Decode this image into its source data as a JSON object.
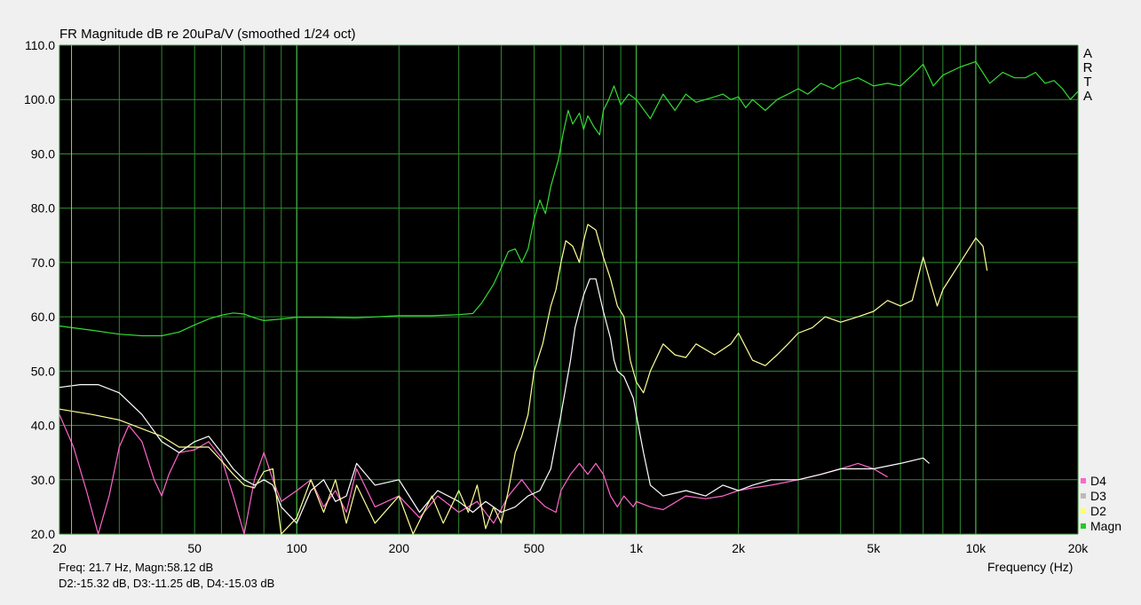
{
  "window": {
    "title": "FR Magnitude dB re 20uPa/V (smoothed 1/24 oct)"
  },
  "brand": {
    "letters": [
      "A",
      "R",
      "T",
      "A"
    ]
  },
  "readout": {
    "line1": "Freq: 21.7 Hz, Magn:58.12 dB",
    "line2": "D2:-15.32 dB, D3:-11.25 dB, D4:-15.03 dB"
  },
  "colors": {
    "plot_bg": "#000000",
    "grid": "#2e8b2e",
    "cursor": "#d4c200",
    "magn": "#33dd33",
    "d2": "#ffff99",
    "d3": "#ffffff",
    "d4": "#ff66cc"
  },
  "chart_data": {
    "type": "line",
    "title": "FR Magnitude dB re 20uPa/V (smoothed 1/24 oct)",
    "xlabel": "Frequency (Hz)",
    "ylabel": "",
    "x_scale": "log",
    "xlim": [
      20,
      20000
    ],
    "ylim": [
      20,
      110
    ],
    "grid": true,
    "legend_position": "bottom-right",
    "cursor_x": 21.7,
    "y_ticks": [
      {
        "value": 110,
        "label": "110.0"
      },
      {
        "value": 100,
        "label": "100.0"
      },
      {
        "value": 90,
        "label": "90.0"
      },
      {
        "value": 80,
        "label": "80.0"
      },
      {
        "value": 70,
        "label": "70.0"
      },
      {
        "value": 60,
        "label": "60.0"
      },
      {
        "value": 50,
        "label": "50.0"
      },
      {
        "value": 40,
        "label": "40.0"
      },
      {
        "value": 30,
        "label": "30.0"
      },
      {
        "value": 20,
        "label": "20.0"
      }
    ],
    "x_ticks": [
      {
        "value": 20,
        "label": "20"
      },
      {
        "value": 50,
        "label": "50"
      },
      {
        "value": 100,
        "label": "100"
      },
      {
        "value": 200,
        "label": "200"
      },
      {
        "value": 500,
        "label": "500"
      },
      {
        "value": 1000,
        "label": "1k"
      },
      {
        "value": 2000,
        "label": "2k"
      },
      {
        "value": 5000,
        "label": "5k"
      },
      {
        "value": 10000,
        "label": "10k"
      },
      {
        "value": 20000,
        "label": "20k"
      }
    ],
    "series": [
      {
        "name": "Magn",
        "color": "#33dd33",
        "points": [
          [
            20,
            58.3
          ],
          [
            25,
            57.5
          ],
          [
            30,
            56.8
          ],
          [
            35,
            56.5
          ],
          [
            40,
            56.5
          ],
          [
            45,
            57.2
          ],
          [
            50,
            58.5
          ],
          [
            55,
            59.6
          ],
          [
            60,
            60.3
          ],
          [
            65,
            60.7
          ],
          [
            70,
            60.5
          ],
          [
            75,
            59.8
          ],
          [
            80,
            59.3
          ],
          [
            90,
            59.6
          ],
          [
            100,
            59.9
          ],
          [
            120,
            59.9
          ],
          [
            150,
            59.8
          ],
          [
            200,
            60.2
          ],
          [
            250,
            60.2
          ],
          [
            300,
            60.4
          ],
          [
            330,
            60.6
          ],
          [
            350,
            62.5
          ],
          [
            380,
            66
          ],
          [
            400,
            69
          ],
          [
            420,
            72
          ],
          [
            440,
            72.5
          ],
          [
            460,
            70
          ],
          [
            480,
            72.5
          ],
          [
            500,
            78
          ],
          [
            520,
            81.5
          ],
          [
            540,
            79
          ],
          [
            560,
            84
          ],
          [
            590,
            89
          ],
          [
            610,
            94
          ],
          [
            630,
            98
          ],
          [
            650,
            95.5
          ],
          [
            680,
            97.5
          ],
          [
            700,
            94.5
          ],
          [
            720,
            97
          ],
          [
            750,
            95
          ],
          [
            780,
            93.5
          ],
          [
            800,
            98
          ],
          [
            830,
            100
          ],
          [
            860,
            102.5
          ],
          [
            900,
            99
          ],
          [
            950,
            101
          ],
          [
            1000,
            100
          ],
          [
            1100,
            96.5
          ],
          [
            1200,
            101
          ],
          [
            1300,
            98
          ],
          [
            1400,
            101
          ],
          [
            1500,
            99.5
          ],
          [
            1700,
            100.5
          ],
          [
            1800,
            101
          ],
          [
            1900,
            100
          ],
          [
            2000,
            100.5
          ],
          [
            2100,
            98.5
          ],
          [
            2200,
            100
          ],
          [
            2400,
            98
          ],
          [
            2600,
            100
          ],
          [
            2800,
            101
          ],
          [
            3000,
            102
          ],
          [
            3200,
            101
          ],
          [
            3500,
            103
          ],
          [
            3800,
            102
          ],
          [
            4000,
            103
          ],
          [
            4500,
            104
          ],
          [
            5000,
            102.5
          ],
          [
            5500,
            103
          ],
          [
            6000,
            102.5
          ],
          [
            6500,
            104.5
          ],
          [
            7000,
            106.5
          ],
          [
            7500,
            102.5
          ],
          [
            8000,
            104.5
          ],
          [
            9000,
            106
          ],
          [
            10000,
            107
          ],
          [
            11000,
            103
          ],
          [
            12000,
            105
          ],
          [
            13000,
            104
          ],
          [
            14000,
            104
          ],
          [
            15000,
            105
          ],
          [
            16000,
            103
          ],
          [
            17000,
            103.5
          ],
          [
            18000,
            102
          ],
          [
            19000,
            100
          ],
          [
            20000,
            101.5
          ]
        ]
      },
      {
        "name": "D2",
        "color": "#ffff99",
        "points": [
          [
            20,
            43
          ],
          [
            25,
            42
          ],
          [
            30,
            41
          ],
          [
            40,
            38
          ],
          [
            45,
            36
          ],
          [
            50,
            36
          ],
          [
            55,
            36
          ],
          [
            60,
            33.5
          ],
          [
            65,
            31
          ],
          [
            70,
            29
          ],
          [
            75,
            28.5
          ],
          [
            80,
            31.5
          ],
          [
            85,
            32
          ],
          [
            90,
            20
          ],
          [
            100,
            23
          ],
          [
            110,
            30
          ],
          [
            120,
            24
          ],
          [
            130,
            30
          ],
          [
            140,
            22
          ],
          [
            150,
            29
          ],
          [
            170,
            22
          ],
          [
            200,
            27
          ],
          [
            220,
            20
          ],
          [
            250,
            27
          ],
          [
            270,
            22
          ],
          [
            300,
            28
          ],
          [
            320,
            24
          ],
          [
            340,
            29
          ],
          [
            360,
            21
          ],
          [
            380,
            25
          ],
          [
            400,
            22
          ],
          [
            420,
            28
          ],
          [
            440,
            35
          ],
          [
            460,
            38
          ],
          [
            480,
            42
          ],
          [
            500,
            50
          ],
          [
            530,
            55
          ],
          [
            560,
            62
          ],
          [
            580,
            65
          ],
          [
            600,
            70
          ],
          [
            620,
            74
          ],
          [
            650,
            73
          ],
          [
            680,
            70
          ],
          [
            700,
            74
          ],
          [
            720,
            77
          ],
          [
            760,
            76
          ],
          [
            800,
            71
          ],
          [
            840,
            67
          ],
          [
            880,
            62
          ],
          [
            920,
            60
          ],
          [
            960,
            52
          ],
          [
            1000,
            48
          ],
          [
            1050,
            46
          ],
          [
            1100,
            50
          ],
          [
            1200,
            55
          ],
          [
            1300,
            53
          ],
          [
            1400,
            52.5
          ],
          [
            1500,
            55
          ],
          [
            1700,
            53
          ],
          [
            1900,
            55
          ],
          [
            2000,
            57
          ],
          [
            2200,
            52
          ],
          [
            2400,
            51
          ],
          [
            2600,
            53
          ],
          [
            2800,
            55
          ],
          [
            3000,
            57
          ],
          [
            3300,
            58
          ],
          [
            3600,
            60
          ],
          [
            4000,
            59
          ],
          [
            4500,
            60
          ],
          [
            5000,
            61
          ],
          [
            5500,
            63
          ],
          [
            6000,
            62
          ],
          [
            6500,
            63
          ],
          [
            7000,
            71
          ],
          [
            7300,
            67
          ],
          [
            7700,
            62
          ],
          [
            8000,
            65
          ],
          [
            9000,
            70
          ],
          [
            10000,
            74.5
          ],
          [
            10500,
            73
          ],
          [
            10800,
            68.5
          ]
        ]
      },
      {
        "name": "D3",
        "color": "#ffffff",
        "points": [
          [
            20,
            47
          ],
          [
            23,
            47.5
          ],
          [
            26,
            47.5
          ],
          [
            30,
            46
          ],
          [
            35,
            42
          ],
          [
            40,
            37
          ],
          [
            45,
            35
          ],
          [
            50,
            37
          ],
          [
            55,
            38
          ],
          [
            60,
            35
          ],
          [
            65,
            32
          ],
          [
            70,
            30
          ],
          [
            75,
            29
          ],
          [
            80,
            30
          ],
          [
            85,
            29
          ],
          [
            90,
            25
          ],
          [
            100,
            22
          ],
          [
            110,
            28
          ],
          [
            120,
            30
          ],
          [
            130,
            26
          ],
          [
            140,
            27
          ],
          [
            150,
            33
          ],
          [
            170,
            29
          ],
          [
            200,
            30
          ],
          [
            230,
            24
          ],
          [
            260,
            28
          ],
          [
            300,
            26
          ],
          [
            330,
            24
          ],
          [
            360,
            26
          ],
          [
            400,
            24
          ],
          [
            440,
            25
          ],
          [
            480,
            27
          ],
          [
            520,
            28
          ],
          [
            560,
            32
          ],
          [
            600,
            42
          ],
          [
            640,
            52
          ],
          [
            660,
            58
          ],
          [
            700,
            64
          ],
          [
            730,
            67
          ],
          [
            760,
            67
          ],
          [
            800,
            61
          ],
          [
            840,
            56
          ],
          [
            860,
            52
          ],
          [
            880,
            50
          ],
          [
            920,
            49
          ],
          [
            980,
            45
          ],
          [
            1000,
            42
          ],
          [
            1050,
            35
          ],
          [
            1100,
            29
          ],
          [
            1200,
            27
          ],
          [
            1400,
            28
          ],
          [
            1600,
            27
          ],
          [
            1800,
            29
          ],
          [
            2000,
            28
          ],
          [
            2200,
            29
          ],
          [
            2500,
            30
          ],
          [
            3000,
            30
          ],
          [
            3500,
            31
          ],
          [
            4000,
            32
          ],
          [
            5000,
            32
          ],
          [
            6000,
            33
          ],
          [
            7000,
            34
          ],
          [
            7300,
            33
          ]
        ]
      },
      {
        "name": "D4",
        "color": "#ff66cc",
        "points": [
          [
            20,
            42
          ],
          [
            22,
            36
          ],
          [
            24,
            28
          ],
          [
            26,
            20
          ],
          [
            28,
            27
          ],
          [
            30,
            36
          ],
          [
            32,
            40
          ],
          [
            35,
            37
          ],
          [
            38,
            30
          ],
          [
            40,
            27
          ],
          [
            42,
            31
          ],
          [
            45,
            35
          ],
          [
            50,
            35.5
          ],
          [
            55,
            37
          ],
          [
            60,
            34
          ],
          [
            65,
            27
          ],
          [
            70,
            20
          ],
          [
            75,
            30
          ],
          [
            80,
            35
          ],
          [
            85,
            30
          ],
          [
            90,
            26
          ],
          [
            100,
            28
          ],
          [
            110,
            30
          ],
          [
            120,
            25
          ],
          [
            130,
            28
          ],
          [
            140,
            24
          ],
          [
            150,
            32
          ],
          [
            170,
            25
          ],
          [
            200,
            27
          ],
          [
            230,
            23
          ],
          [
            260,
            27
          ],
          [
            300,
            24
          ],
          [
            340,
            26
          ],
          [
            380,
            22
          ],
          [
            420,
            27
          ],
          [
            460,
            30
          ],
          [
            500,
            27
          ],
          [
            540,
            25
          ],
          [
            580,
            24
          ],
          [
            600,
            28
          ],
          [
            640,
            31
          ],
          [
            680,
            33
          ],
          [
            720,
            31
          ],
          [
            760,
            33
          ],
          [
            800,
            31
          ],
          [
            840,
            27
          ],
          [
            880,
            25
          ],
          [
            920,
            27
          ],
          [
            980,
            25
          ],
          [
            1000,
            26
          ],
          [
            1100,
            25
          ],
          [
            1200,
            24.5
          ],
          [
            1400,
            27
          ],
          [
            1600,
            26.5
          ],
          [
            1800,
            27
          ],
          [
            2000,
            28
          ],
          [
            2200,
            28.5
          ],
          [
            2500,
            29
          ],
          [
            3000,
            30
          ],
          [
            3500,
            31
          ],
          [
            4000,
            32
          ],
          [
            4500,
            33
          ],
          [
            5000,
            32
          ],
          [
            5500,
            30.5
          ]
        ]
      }
    ]
  }
}
